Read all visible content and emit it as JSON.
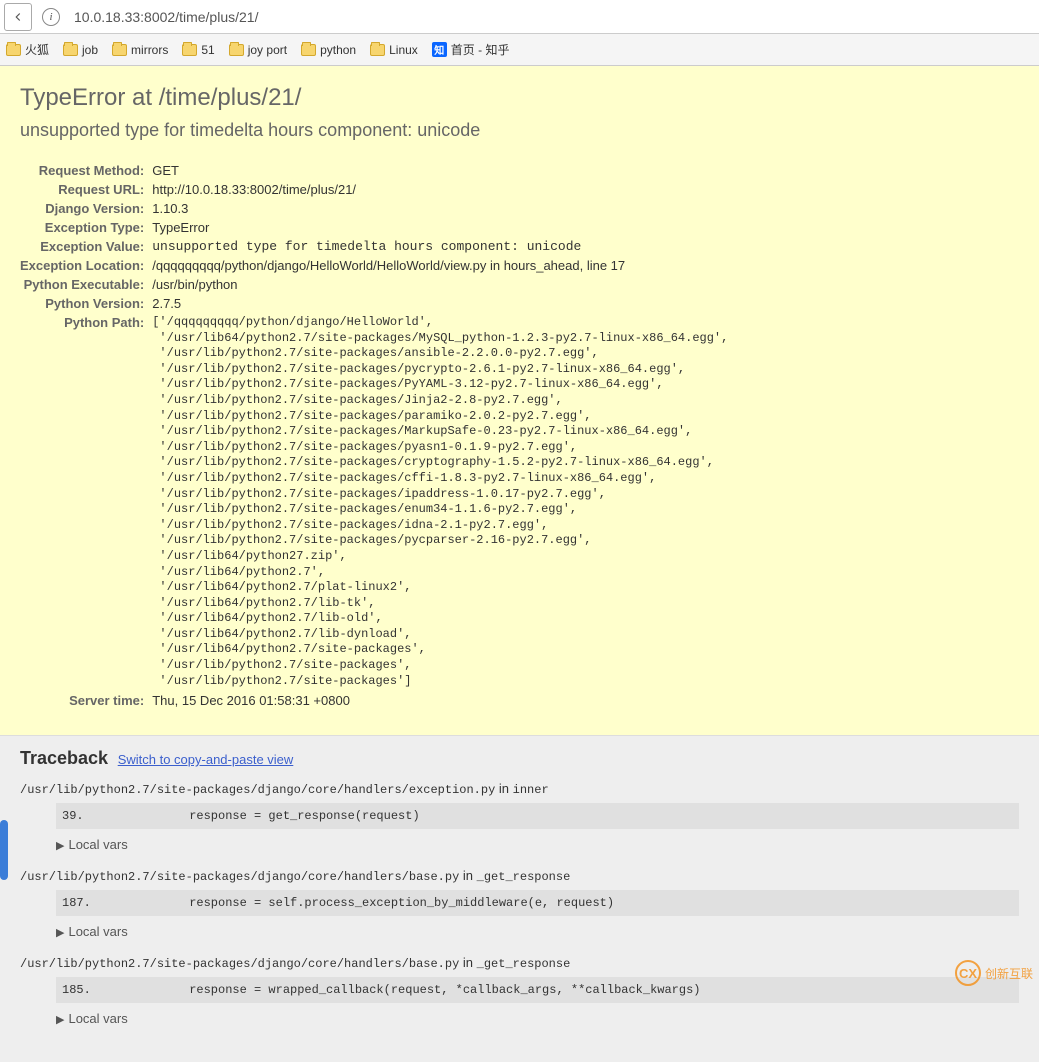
{
  "browser": {
    "url": "10.0.18.33:8002/time/plus/21/",
    "bookmarks": [
      "火狐",
      "job",
      "mirrors",
      "51",
      "joy port",
      "python",
      "Linux"
    ],
    "zhihu_label": "首页 - 知乎",
    "zhihu_badge": "知"
  },
  "summary": {
    "title": "TypeError at /time/plus/21/",
    "subtitle": "unsupported type for timedelta hours component: unicode",
    "rows": {
      "request_method_label": "Request Method:",
      "request_method": "GET",
      "request_url_label": "Request URL:",
      "request_url": "http://10.0.18.33:8002/time/plus/21/",
      "django_version_label": "Django Version:",
      "django_version": "1.10.3",
      "exception_type_label": "Exception Type:",
      "exception_type": "TypeError",
      "exception_value_label": "Exception Value:",
      "exception_value": "unsupported type for timedelta hours component: unicode",
      "exception_location_label": "Exception Location:",
      "exception_location": "/qqqqqqqqq/python/django/HelloWorld/HelloWorld/view.py in hours_ahead, line 17",
      "python_executable_label": "Python Executable:",
      "python_executable": "/usr/bin/python",
      "python_version_label": "Python Version:",
      "python_version": "2.7.5",
      "python_path_label": "Python Path:",
      "python_path": "['/qqqqqqqqq/python/django/HelloWorld',\n '/usr/lib64/python2.7/site-packages/MySQL_python-1.2.3-py2.7-linux-x86_64.egg',\n '/usr/lib/python2.7/site-packages/ansible-2.2.0.0-py2.7.egg',\n '/usr/lib/python2.7/site-packages/pycrypto-2.6.1-py2.7-linux-x86_64.egg',\n '/usr/lib/python2.7/site-packages/PyYAML-3.12-py2.7-linux-x86_64.egg',\n '/usr/lib/python2.7/site-packages/Jinja2-2.8-py2.7.egg',\n '/usr/lib/python2.7/site-packages/paramiko-2.0.2-py2.7.egg',\n '/usr/lib/python2.7/site-packages/MarkupSafe-0.23-py2.7-linux-x86_64.egg',\n '/usr/lib/python2.7/site-packages/pyasn1-0.1.9-py2.7.egg',\n '/usr/lib/python2.7/site-packages/cryptography-1.5.2-py2.7-linux-x86_64.egg',\n '/usr/lib/python2.7/site-packages/cffi-1.8.3-py2.7-linux-x86_64.egg',\n '/usr/lib/python2.7/site-packages/ipaddress-1.0.17-py2.7.egg',\n '/usr/lib/python2.7/site-packages/enum34-1.1.6-py2.7.egg',\n '/usr/lib/python2.7/site-packages/idna-2.1-py2.7.egg',\n '/usr/lib/python2.7/site-packages/pycparser-2.16-py2.7.egg',\n '/usr/lib64/python27.zip',\n '/usr/lib64/python2.7',\n '/usr/lib64/python2.7/plat-linux2',\n '/usr/lib64/python2.7/lib-tk',\n '/usr/lib64/python2.7/lib-old',\n '/usr/lib64/python2.7/lib-dynload',\n '/usr/lib64/python2.7/site-packages',\n '/usr/lib/python2.7/site-packages',\n '/usr/lib/python2.7/site-packages']",
      "server_time_label": "Server time:",
      "server_time": "Thu, 15 Dec 2016 01:58:31 +0800"
    }
  },
  "traceback": {
    "heading": "Traceback",
    "switch_label": "Switch to copy-and-paste view",
    "local_vars_label": "Local vars",
    "frames": [
      {
        "file": "/usr/lib/python2.7/site-packages/django/core/handlers/exception.py",
        "in": "in",
        "func": "inner",
        "lineno": "39.",
        "code": "            response = get_response(request)"
      },
      {
        "file": "/usr/lib/python2.7/site-packages/django/core/handlers/base.py",
        "in": "in",
        "func": "_get_response",
        "lineno": "187.",
        "code": "                response = self.process_exception_by_middleware(e, request)"
      },
      {
        "file": "/usr/lib/python2.7/site-packages/django/core/handlers/base.py",
        "in": "in",
        "func": "_get_response",
        "lineno": "185.",
        "code": "                response = wrapped_callback(request, *callback_args, **callback_kwargs)"
      }
    ]
  },
  "watermark": "创新互联"
}
